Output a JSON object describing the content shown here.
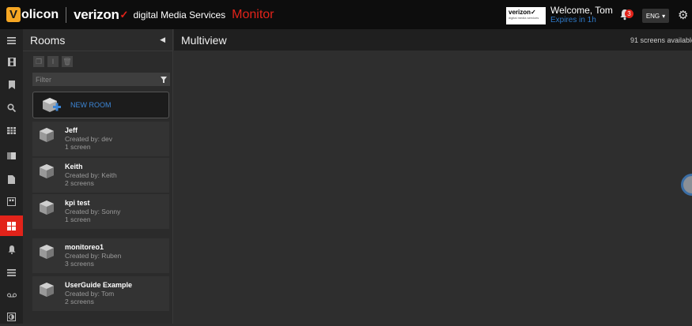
{
  "header": {
    "logo_letter": "V",
    "logo_rest": "olicon",
    "brand": "verizon",
    "brand_check": "✓",
    "service": "digital Media Services",
    "product": "Monitor",
    "badge_name": "verizon✓",
    "badge_sub": "digital media services",
    "welcome": "Welcome, Tom",
    "expires": "Expires in 1h",
    "notification_count": "3",
    "language": "ENG",
    "accent_color": "#e2231a"
  },
  "nav": {
    "icons": [
      "menu-icon",
      "film-icon",
      "bookmark-icon",
      "search-icon",
      "table-icon",
      "gradient-icon",
      "file-icon",
      "layout-icon",
      "grid-icon",
      "bell-icon",
      "list-icon",
      "voicemail-icon",
      "contrast-icon"
    ],
    "active": "grid-icon"
  },
  "rooms_panel": {
    "title": "Rooms",
    "filter_placeholder": "Filter",
    "new_room_label": "NEW ROOM",
    "rooms": [
      {
        "name": "Jeff",
        "created_by": "Created by: dev",
        "screens": "1 screen"
      },
      {
        "name": "Keith",
        "created_by": "Created by: Keith",
        "screens": "2 screens"
      },
      {
        "name": "kpi test",
        "created_by": "Created by: Sonny",
        "screens": "1 screen"
      },
      {
        "name": "monitoreo1",
        "created_by": "Created by: Ruben",
        "screens": "3 screens"
      },
      {
        "name": "UserGuide Example",
        "created_by": "Created by: Tom",
        "screens": "2 screens"
      }
    ]
  },
  "main": {
    "title": "Multiview",
    "screens_available": "91 screens available"
  }
}
